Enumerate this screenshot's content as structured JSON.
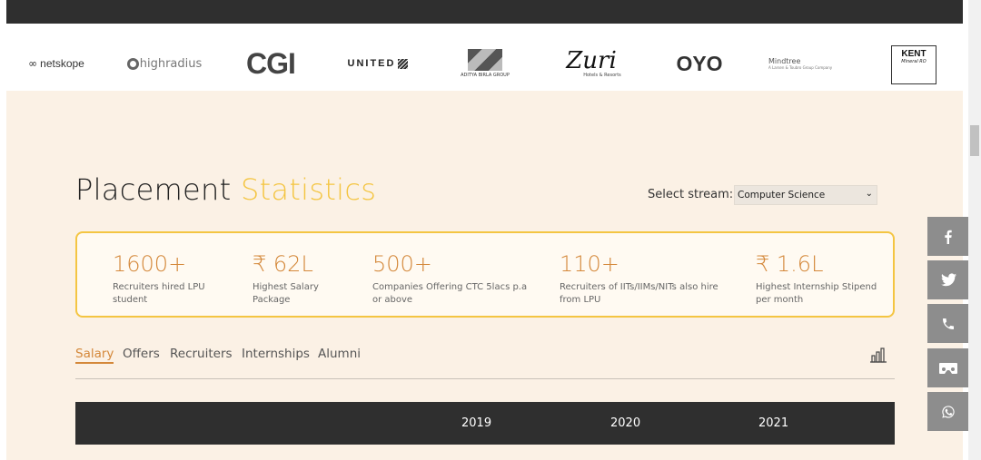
{
  "logos": [
    {
      "name": "netskope",
      "text": "netskope"
    },
    {
      "name": "highradius",
      "text": "highradius"
    },
    {
      "name": "cgi",
      "text": "CGI"
    },
    {
      "name": "united",
      "text": "UNITED"
    },
    {
      "name": "aditya-birla",
      "text": "ADITYA BIRLA GROUP"
    },
    {
      "name": "zuri",
      "text": "Zuri",
      "sub": "Hotels & Resorts"
    },
    {
      "name": "oyo",
      "text": "OYO"
    },
    {
      "name": "mindtree",
      "text": "Mindtree",
      "sub": "A Larsen & Toubro Group Company"
    },
    {
      "name": "kent",
      "text": "KENT",
      "sub": "Mineral RO"
    }
  ],
  "title": {
    "main": "Placement",
    "accent": "Statistics"
  },
  "stream": {
    "label": "Select stream:",
    "selected": "Computer Science"
  },
  "stats": [
    {
      "value": "1600+",
      "label": "Recruiters hired LPU student"
    },
    {
      "value": "₹ 62L",
      "label": "Highest Salary Package"
    },
    {
      "value": "500+",
      "label": "Companies Offering CTC 5lacs p.a or above"
    },
    {
      "value": "110+",
      "label": "Recruiters of IITs/IIMs/NITs also hire from LPU"
    },
    {
      "value": "₹ 1.6L",
      "label": "Highest Internship Stipend per month"
    }
  ],
  "tabs": [
    "Salary",
    "Offers",
    "Recruiters",
    "Internships",
    "Alumni"
  ],
  "table": {
    "years": [
      "2019",
      "2020",
      "2021"
    ]
  },
  "social": [
    "facebook",
    "twitter",
    "phone",
    "vr-headset",
    "whatsapp"
  ],
  "colors": {
    "accent": "#f4c542",
    "orange": "#d4883a",
    "bg": "#fbf1e5",
    "dark": "#2f2f2f",
    "social": "#8d8d8d"
  }
}
